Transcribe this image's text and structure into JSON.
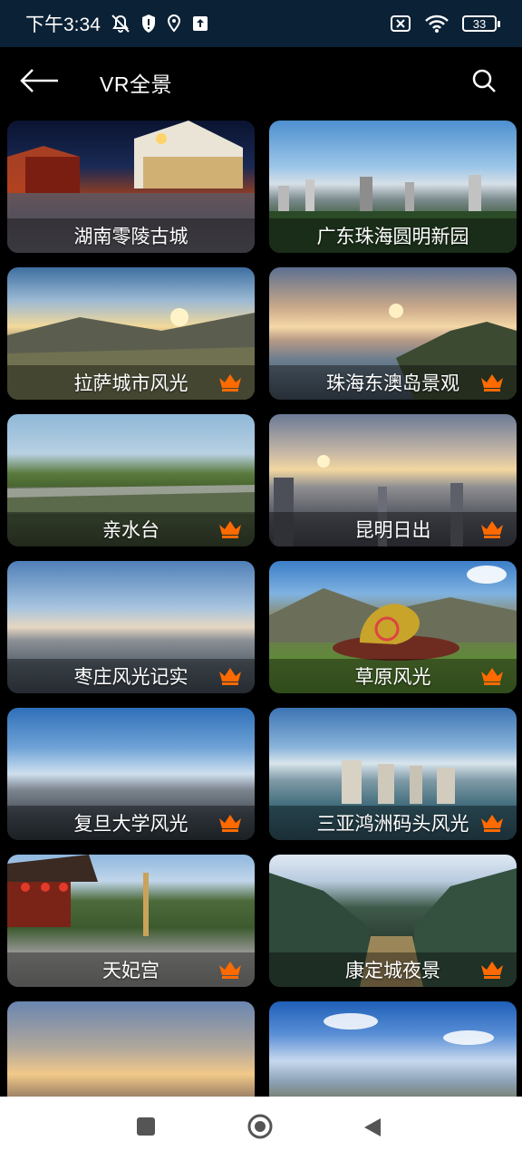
{
  "status_bar": {
    "time": "下午3:34",
    "battery": "33",
    "icons": [
      "notifications-off-icon",
      "shield-alert-icon",
      "location-icon",
      "upload-icon",
      "sim-off-icon",
      "wifi-icon",
      "battery-icon"
    ]
  },
  "header": {
    "title": "VR全景",
    "back_icon": "arrow-left-icon",
    "search_icon": "search-icon"
  },
  "colors": {
    "status_bg": "#0b2136",
    "page_bg": "#000000",
    "crown": "#ff6a00",
    "nav_bg": "#ffffff",
    "nav_icon": "#555555"
  },
  "cards": [
    {
      "title": "湖南零陵古城",
      "premium": false
    },
    {
      "title": "广东珠海圆明新园",
      "premium": false
    },
    {
      "title": "拉萨城市风光",
      "premium": true
    },
    {
      "title": "珠海东澳岛景观",
      "premium": true
    },
    {
      "title": "亲水台",
      "premium": true
    },
    {
      "title": "昆明日出",
      "premium": true
    },
    {
      "title": "枣庄风光记实",
      "premium": true
    },
    {
      "title": "草原风光",
      "premium": true
    },
    {
      "title": "复旦大学风光",
      "premium": true
    },
    {
      "title": "三亚鸿洲码头风光",
      "premium": true
    },
    {
      "title": "天妃宫",
      "premium": true
    },
    {
      "title": "康定城夜景",
      "premium": true
    },
    {
      "title": "",
      "premium": false
    },
    {
      "title": "",
      "premium": false
    }
  ],
  "nav_bar": {
    "icons": [
      "recents-square-icon",
      "home-circle-icon",
      "back-triangle-icon"
    ]
  }
}
